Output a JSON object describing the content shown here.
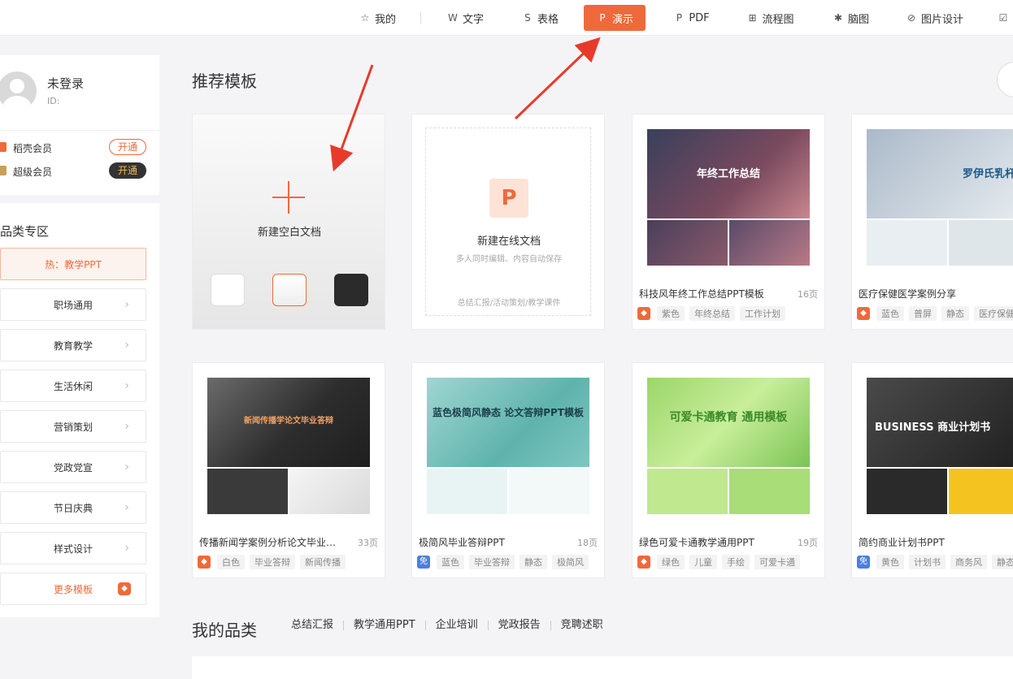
{
  "nav": {
    "items": [
      {
        "label": "我的",
        "icon": "star-icon"
      },
      {
        "label": "文字",
        "icon": "w-icon"
      },
      {
        "label": "表格",
        "icon": "s-icon"
      },
      {
        "label": "演示",
        "icon": "p-icon"
      },
      {
        "label": "PDF",
        "icon": "pdf-icon"
      },
      {
        "label": "流程图",
        "icon": "flowchart-icon"
      },
      {
        "label": "脑图",
        "icon": "mindmap-icon"
      },
      {
        "label": "图片设计",
        "icon": "image-design-icon"
      }
    ],
    "active": "演示",
    "accent": "#f0693a"
  },
  "user": {
    "name": "未登录",
    "id_label": "ID:",
    "memberships": [
      {
        "label": "稻壳会员",
        "button": "开通"
      },
      {
        "label": "超级会员",
        "button": "开通"
      }
    ]
  },
  "categories": {
    "title": "品类专区",
    "items": [
      "热：教学PPT",
      "职场通用",
      "教育教学",
      "生活休闲",
      "营销策划",
      "党政党宣",
      "节日庆典",
      "样式设计",
      "更多模板"
    ]
  },
  "recommended": {
    "title": "推荐模板",
    "blank": {
      "label": "新建空白文档"
    },
    "online": {
      "title": "新建在线文档",
      "subtitle": "多人同时编辑、内容自动保存",
      "tags": "总结汇报/活动策划/教学课件"
    },
    "templates": [
      {
        "name": "科技风年终工作总结PPT模板",
        "pages": "16页",
        "badge": "",
        "tags": [
          "紫色",
          "年终总结",
          "工作计划"
        ],
        "thumb_text": "年终工作总结"
      },
      {
        "name": "医疗保健医学案例分享",
        "pages": "",
        "badge": "",
        "tags": [
          "蓝色",
          "普屏",
          "静态",
          "医疗保健"
        ],
        "thumb_text": "罗伊氏乳杆菌"
      },
      {
        "name": "传播新闻学案例分析论文毕业答辩",
        "pages": "33页",
        "badge": "",
        "tags": [
          "白色",
          "毕业答辩",
          "新闻传播"
        ],
        "thumb_text": "新闻传播学论文毕业答辩"
      },
      {
        "name": "极简风毕业答辩PPT",
        "pages": "18页",
        "badge": "免",
        "tags": [
          "蓝色",
          "毕业答辩",
          "静态",
          "极简风"
        ],
        "thumb_text": "蓝色极简风静态 论文答辩PPT模板"
      },
      {
        "name": "绿色可爱卡通教学通用PPT",
        "pages": "19页",
        "badge": "",
        "tags": [
          "绿色",
          "儿童",
          "手绘",
          "可爱卡通"
        ],
        "thumb_text": "可爱卡通教育 通用模板"
      },
      {
        "name": "简约商业计划书PPT",
        "pages": "",
        "badge": "免",
        "tags": [
          "黄色",
          "计划书",
          "商务风",
          "静态"
        ],
        "thumb_text": "BUSINESS 商业计划书"
      }
    ]
  },
  "my_categories": {
    "title": "我的品类",
    "links": [
      "总结汇报",
      "教学通用PPT",
      "企业培训",
      "党政报告",
      "竞聘述职"
    ]
  }
}
